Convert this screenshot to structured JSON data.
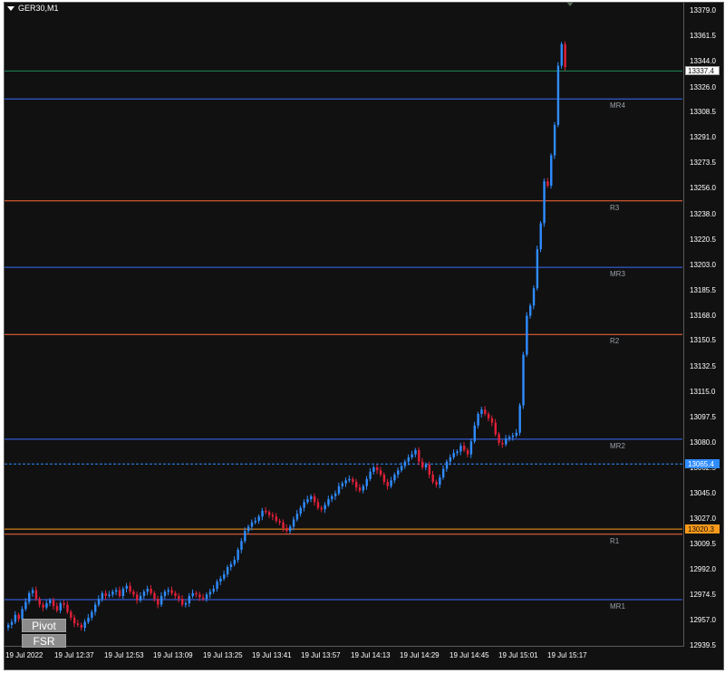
{
  "window": {
    "title": "GER30,M1"
  },
  "buttons": {
    "pivot": "Pivot",
    "fsr": "FSR"
  },
  "colors": {
    "background": "#111111",
    "bull": "#2f8cff",
    "bear": "#e2203a",
    "pivot_m": "#3a6cff",
    "pivot_r": "#ff6a3a",
    "bid": "#2f8cff",
    "ask": "#ff9a1a",
    "last": "#1e8a5a"
  },
  "price_axis": {
    "ticks": [
      "13379.0",
      "13361.5",
      "13344.0",
      "13326.0",
      "13308.5",
      "13291.0",
      "13273.5",
      "13256.0",
      "13238.0",
      "13220.5",
      "13203.0",
      "13185.5",
      "13168.0",
      "13150.5",
      "13132.5",
      "13115.0",
      "13097.5",
      "13080.0",
      "13062.5",
      "13045.0",
      "13027.0",
      "13009.5",
      "12992.0",
      "12974.5",
      "12957.0",
      "12939.5"
    ],
    "current_tags": [
      {
        "label": "13337.4",
        "style": "last"
      },
      {
        "label": "13065.4",
        "style": "bid"
      },
      {
        "label": "13020.3",
        "style": "ask"
      }
    ]
  },
  "time_axis": {
    "labels": [
      "19 Jul 2022",
      "19 Jul 12:37",
      "19 Jul 12:53",
      "19 Jul 13:09",
      "19 Jul 13:25",
      "19 Jul 13:41",
      "19 Jul 13:57",
      "19 Jul 14:13",
      "19 Jul 14:29",
      "19 Jul 14:45",
      "19 Jul 15:01",
      "19 Jul 15:17"
    ]
  },
  "pivot_levels": [
    {
      "name": "MR4",
      "value": 13318.0,
      "kind": "m"
    },
    {
      "name": "R3",
      "value": 13247.5,
      "kind": "r"
    },
    {
      "name": "MR3",
      "value": 13201.5,
      "kind": "m"
    },
    {
      "name": "R2",
      "value": 13155.0,
      "kind": "r"
    },
    {
      "name": "MR2",
      "value": 13082.5,
      "kind": "m"
    },
    {
      "name": "R1",
      "value": 13016.8,
      "kind": "r"
    },
    {
      "name": "MR1",
      "value": 12971.5,
      "kind": "m"
    }
  ],
  "chart_data": {
    "type": "candlestick",
    "title": "GER30,M1",
    "ylim": [
      12939.5,
      13379.0
    ],
    "closes": [
      12954,
      12956,
      12961,
      12958,
      12965,
      12970,
      12976,
      12978,
      12972,
      12968,
      12966,
      12969,
      12971,
      12967,
      12964,
      12969,
      12968,
      12963,
      12959,
      12955,
      12954,
      12952,
      12956,
      12959,
      12963,
      12968,
      12972,
      12976,
      12974,
      12975,
      12977,
      12978,
      12974,
      12979,
      12981,
      12977,
      12975,
      12971,
      12974,
      12977,
      12979,
      12976,
      12972,
      12968,
      12974,
      12977,
      12978,
      12976,
      12974,
      12972,
      12968,
      12969,
      12974,
      12976,
      12975,
      12973,
      12972,
      12975,
      12977,
      12979,
      12984,
      12986,
      12989,
      12994,
      12996,
      12999,
      13006,
      13012,
      13019,
      13022,
      13025,
      13026,
      13029,
      13033,
      13032,
      13030,
      13029,
      13026,
      13025,
      13021,
      13019,
      13022,
      13027,
      13031,
      13035,
      13039,
      13041,
      13043,
      13039,
      13035,
      13034,
      13037,
      13041,
      13043,
      13045,
      13050,
      13052,
      13054,
      13055,
      13053,
      13049,
      13047,
      13050,
      13055,
      13060,
      13063,
      13061,
      13058,
      13053,
      13050,
      13054,
      13058,
      13061,
      13064,
      13067,
      13070,
      13072,
      13075,
      13067,
      13063,
      13065,
      13058,
      13053,
      13051,
      13056,
      13062,
      13067,
      13070,
      13073,
      13074,
      13078,
      13075,
      13072,
      13081,
      13092,
      13100,
      13103,
      13100,
      13097,
      13094,
      13086,
      13080,
      13079,
      13083,
      13084,
      13085,
      13087,
      13106,
      13141,
      13168,
      13175,
      13187,
      13214,
      13232,
      13261,
      13258,
      13279,
      13300,
      13341,
      13356,
      13340
    ]
  }
}
